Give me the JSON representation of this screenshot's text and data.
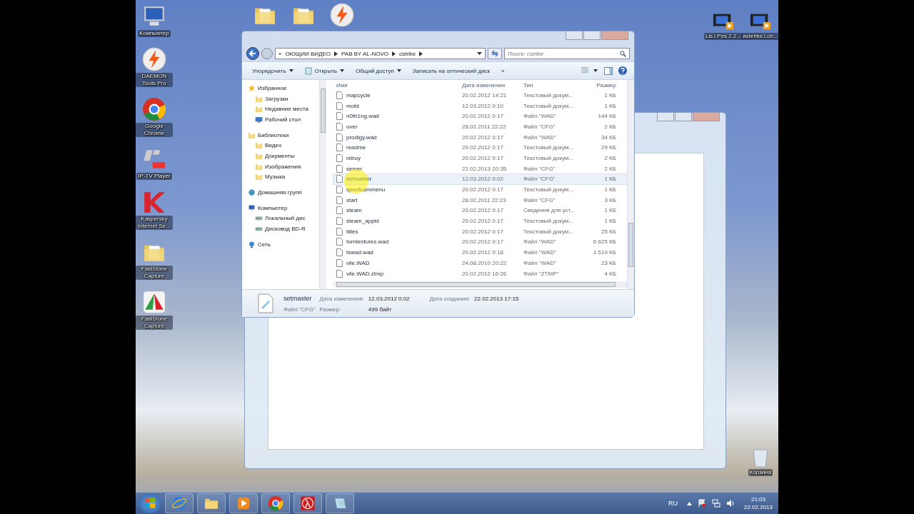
{
  "desktop": {
    "left_icons": [
      {
        "label": "Компьютер",
        "kind": "computer"
      },
      {
        "label": "DAEMON Tools Pro",
        "kind": "daemon"
      },
      {
        "label": "Google Chrome",
        "kind": "chrome"
      },
      {
        "label": "IP-TV Player",
        "kind": "iptv"
      },
      {
        "label": "Kaspersky Internet Se...",
        "kind": "kaspersky"
      },
      {
        "label": "FastStone Capture",
        "kind": "folder"
      },
      {
        "label": "FastStone Capture",
        "kind": "faststone"
      }
    ],
    "top_icons": [
      {
        "kind": "folder"
      },
      {
        "kind": "folder"
      },
      {
        "kind": "daemon"
      }
    ],
    "right_icons": [
      {
        "label": "Lis.i.Pes.2.2...",
        "kind": "video"
      },
      {
        "label": "asteriks.i.ob...",
        "kind": "video"
      }
    ],
    "recycle_bin": {
      "label": "Корзина"
    }
  },
  "explorer": {
    "overflow_mark": "«",
    "breadcrumb": [
      "ОЮЩИИ ВИДЕО",
      "PAB BY AL-NOVO",
      "cstrike"
    ],
    "search": {
      "placeholder": "Поиск: cstrike"
    },
    "toolbar": [
      {
        "label": "Упорядочить",
        "dropdown": true
      },
      {
        "label": "Открыть",
        "dropdown": true
      },
      {
        "label": "Общий доступ",
        "dropdown": true
      },
      {
        "label": "Записать на оптический диск",
        "dropdown": false
      }
    ],
    "toolbar_more": "»",
    "nav": [
      {
        "label": "Избранное",
        "kind": "star",
        "children": [
          {
            "label": "Загрузки",
            "kind": "folder"
          },
          {
            "label": "Недавние места",
            "kind": "folder"
          },
          {
            "label": "Рабочий стол",
            "kind": "desktop"
          }
        ]
      },
      {
        "label": "Библиотеки",
        "kind": "folder",
        "children": [
          {
            "label": "Видео",
            "kind": "folder"
          },
          {
            "label": "Документы",
            "kind": "folder"
          },
          {
            "label": "Изображения",
            "kind": "folder"
          },
          {
            "label": "Музыка",
            "kind": "folder"
          }
        ]
      },
      {
        "label": "Домашняя групп",
        "kind": "group"
      },
      {
        "label": "Компьютер",
        "kind": "computer",
        "children": [
          {
            "label": "Локальный дис",
            "kind": "drive"
          },
          {
            "label": "Дисковод BD-R",
            "kind": "drive"
          }
        ]
      },
      {
        "label": "Сеть",
        "kind": "network"
      }
    ],
    "columns": [
      "Имя",
      "Дата изменения",
      "Тип",
      "Размер"
    ],
    "rows": [
      {
        "name": "mapcycle",
        "date": "20.02.2012 14:21",
        "type": "Текстовый докум...",
        "size": "1 КБ",
        "selected": false
      },
      {
        "name": "motd",
        "date": "12.03.2012 0:10",
        "type": "Текстовый докум...",
        "size": "1 КБ",
        "selected": false
      },
      {
        "name": "n0th1ng.wad",
        "date": "20.02.2012 0:17",
        "type": "Файл \"WAD\"",
        "size": "144 КБ",
        "selected": false
      },
      {
        "name": "over",
        "date": "28.02.2011 22:22",
        "type": "Файл \"CFG\"",
        "size": "2 КБ",
        "selected": false
      },
      {
        "name": "prodigy.wad",
        "date": "20.02.2012 0:17",
        "type": "Файл \"WAD\"",
        "size": "34 КБ",
        "selected": false
      },
      {
        "name": "readme",
        "date": "20.02.2012 0:17",
        "type": "Текстовый докум...",
        "size": "29 КБ",
        "selected": false
      },
      {
        "name": "rebuy",
        "date": "20.02.2012 0:17",
        "type": "Текстовый докум...",
        "size": "2 КБ",
        "selected": false
      },
      {
        "name": "server",
        "date": "22.02.2013 20:35",
        "type": "Файл \"CFG\"",
        "size": "2 КБ",
        "selected": false
      },
      {
        "name": "setmaster",
        "date": "12.03.2012 0:02",
        "type": "Файл \"CFG\"",
        "size": "1 КБ",
        "selected": true
      },
      {
        "name": "spectcammenu",
        "date": "20.02.2012 0:17",
        "type": "Текстовый докум...",
        "size": "1 КБ",
        "selected": false
      },
      {
        "name": "start",
        "date": "28.02.2011 22:23",
        "type": "Файл \"CFG\"",
        "size": "3 КБ",
        "selected": false
      },
      {
        "name": "steam",
        "date": "20.02.2012 0:17",
        "type": "Сведения для уст...",
        "size": "1 КБ",
        "selected": false
      },
      {
        "name": "steam_appid",
        "date": "20.02.2012 0:17",
        "type": "Текстовый докум...",
        "size": "1 КБ",
        "selected": false
      },
      {
        "name": "titles",
        "date": "20.02.2012 0:17",
        "type": "Текстовый докум...",
        "size": "25 КБ",
        "selected": false
      },
      {
        "name": "torntextures.wad",
        "date": "20.02.2012 0:17",
        "type": "Файл \"WAD\"",
        "size": "6 625 КБ",
        "selected": false
      },
      {
        "name": "tswad.wad",
        "date": "20.02.2012 0:18",
        "type": "Файл \"WAD\"",
        "size": "1 519 КБ",
        "selected": false
      },
      {
        "name": "vile.WAD",
        "date": "24.08.2010 20:22",
        "type": "Файл \"WAD\"",
        "size": "23 КБ",
        "selected": false
      },
      {
        "name": "vile.WAD.ztmp",
        "date": "20.02.2012 16:26",
        "type": "Файл \"ZTMP\"",
        "size": "4 КБ",
        "selected": false
      }
    ],
    "details": {
      "name": "setmaster",
      "type": "Файл \"CFG\"",
      "modified_label": "Дата изменения:",
      "modified": "12.03.2012 0:02",
      "created_label": "Дата создания:",
      "created": "22.02.2013 17:15",
      "size_label": "Размер:",
      "size": "499 байт"
    }
  },
  "taskbar": {
    "items": [
      {
        "kind": "ie"
      },
      {
        "kind": "explorer"
      },
      {
        "kind": "media"
      },
      {
        "kind": "chrome"
      },
      {
        "kind": "halflife"
      },
      {
        "kind": "notepad"
      }
    ],
    "language": "RU",
    "time": "21:03",
    "date": "22.02.2013"
  }
}
